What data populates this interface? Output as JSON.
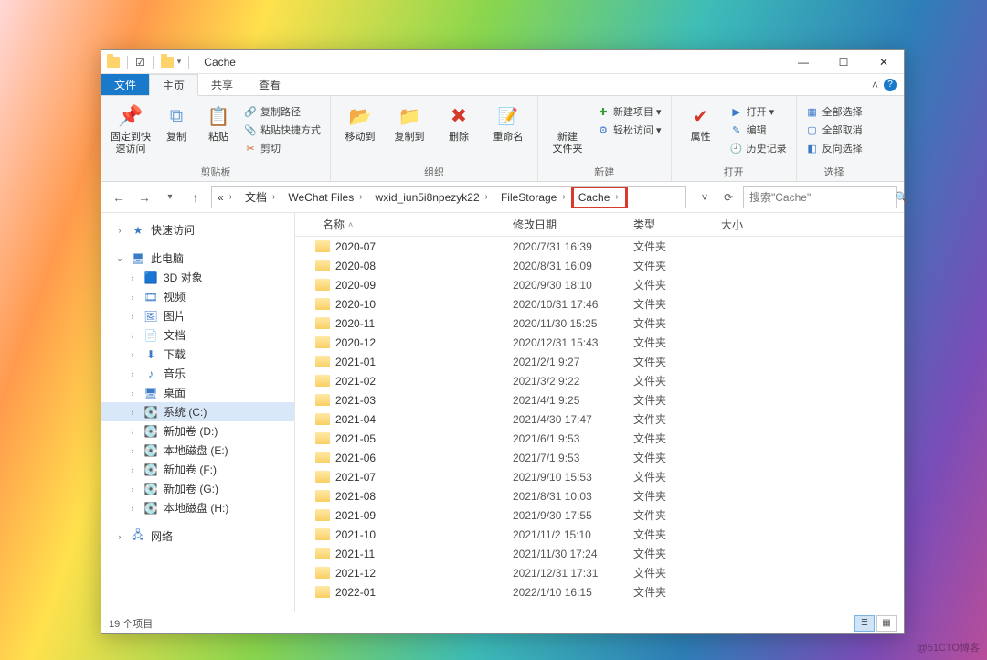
{
  "title": "Cache",
  "tabs": {
    "file": "文件",
    "home": "主页",
    "share": "共享",
    "view": "查看"
  },
  "ribbon": {
    "pin": "固定到快\n速访问",
    "copy": "复制",
    "paste": "粘贴",
    "copypath": "复制路径",
    "pasteshortcut": "粘贴快捷方式",
    "cut": "剪切",
    "group_clip": "剪贴板",
    "moveto": "移动到",
    "copyto": "复制到",
    "delete": "删除",
    "rename": "重命名",
    "group_org": "组织",
    "newfolder": "新建\n文件夹",
    "newitem": "新建项目 ▾",
    "easyaccess": "轻松访问 ▾",
    "group_new": "新建",
    "props": "属性",
    "open": "打开 ▾",
    "edit": "编辑",
    "history": "历史记录",
    "group_open": "打开",
    "selectall": "全部选择",
    "selectnone": "全部取消",
    "invert": "反向选择",
    "group_select": "选择"
  },
  "breadcrumb": [
    "«",
    "文档",
    "WeChat Files",
    "wxid_iun5i8npezyk22",
    "FileStorage",
    "Cache"
  ],
  "search_placeholder": "搜索\"Cache\"",
  "columns": {
    "name": "名称",
    "date": "修改日期",
    "type": "类型",
    "size": "大小"
  },
  "sidebar": {
    "quick": "快速访问",
    "pc": "此电脑",
    "items": [
      "3D 对象",
      "视频",
      "图片",
      "文档",
      "下载",
      "音乐",
      "桌面",
      "系统 (C:)",
      "新加卷 (D:)",
      "本地磁盘 (E:)",
      "新加卷 (F:)",
      "新加卷 (G:)",
      "本地磁盘 (H:)"
    ],
    "network": "网络"
  },
  "rows": [
    {
      "name": "2020-07",
      "date": "2020/7/31 16:39",
      "type": "文件夹"
    },
    {
      "name": "2020-08",
      "date": "2020/8/31 16:09",
      "type": "文件夹"
    },
    {
      "name": "2020-09",
      "date": "2020/9/30 18:10",
      "type": "文件夹"
    },
    {
      "name": "2020-10",
      "date": "2020/10/31 17:46",
      "type": "文件夹"
    },
    {
      "name": "2020-11",
      "date": "2020/11/30 15:25",
      "type": "文件夹"
    },
    {
      "name": "2020-12",
      "date": "2020/12/31 15:43",
      "type": "文件夹"
    },
    {
      "name": "2021-01",
      "date": "2021/2/1 9:27",
      "type": "文件夹"
    },
    {
      "name": "2021-02",
      "date": "2021/3/2 9:22",
      "type": "文件夹"
    },
    {
      "name": "2021-03",
      "date": "2021/4/1 9:25",
      "type": "文件夹"
    },
    {
      "name": "2021-04",
      "date": "2021/4/30 17:47",
      "type": "文件夹"
    },
    {
      "name": "2021-05",
      "date": "2021/6/1 9:53",
      "type": "文件夹"
    },
    {
      "name": "2021-06",
      "date": "2021/7/1 9:53",
      "type": "文件夹"
    },
    {
      "name": "2021-07",
      "date": "2021/9/10 15:53",
      "type": "文件夹"
    },
    {
      "name": "2021-08",
      "date": "2021/8/31 10:03",
      "type": "文件夹"
    },
    {
      "name": "2021-09",
      "date": "2021/9/30 17:55",
      "type": "文件夹"
    },
    {
      "name": "2021-10",
      "date": "2021/11/2 15:10",
      "type": "文件夹"
    },
    {
      "name": "2021-11",
      "date": "2021/11/30 17:24",
      "type": "文件夹"
    },
    {
      "name": "2021-12",
      "date": "2021/12/31 17:31",
      "type": "文件夹"
    },
    {
      "name": "2022-01",
      "date": "2022/1/10 16:15",
      "type": "文件夹"
    }
  ],
  "status": "19 个项目",
  "watermark": "@51CTO博客"
}
